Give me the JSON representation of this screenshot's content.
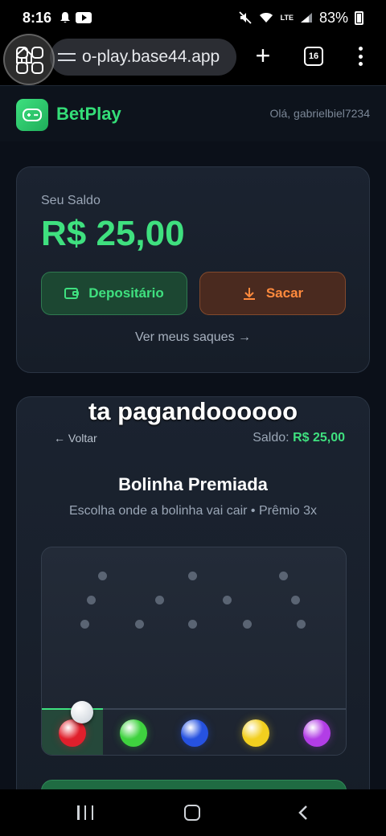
{
  "status_bar": {
    "time": "8:16",
    "battery": "83%",
    "network": "LTE"
  },
  "browser": {
    "url": "o-play.base44.app",
    "tab_count": "16"
  },
  "header": {
    "brand": "BetPlay",
    "greeting": "Olá, gabrielbiel7234"
  },
  "balance": {
    "label": "Seu Saldo",
    "value": "R$ 25,00",
    "deposit_label": "Depositário",
    "withdraw_label": "Sacar",
    "history_link": "Ver meus saques →"
  },
  "game": {
    "overlay_caption": "ta pagandoooooo",
    "back_label": "← Voltar",
    "saldo_label": "Saldo:",
    "saldo_value": "R$ 25,00",
    "title": "Bolinha Premiada",
    "subtitle": "Escolha onde a bolinha vai cair • Prêmio 3x",
    "selected_slot": 1,
    "slots": [
      {
        "color": "#e01f2c",
        "name": "red"
      },
      {
        "color": "#3fd23f",
        "name": "green"
      },
      {
        "color": "#2652e0",
        "name": "blue"
      },
      {
        "color": "#f2cf1f",
        "name": "yellow"
      },
      {
        "color": "#b23de6",
        "name": "purple"
      }
    ]
  },
  "colors": {
    "accent_green": "#3fe07f",
    "accent_orange": "#ff8a3d",
    "background": "#0b1019"
  }
}
